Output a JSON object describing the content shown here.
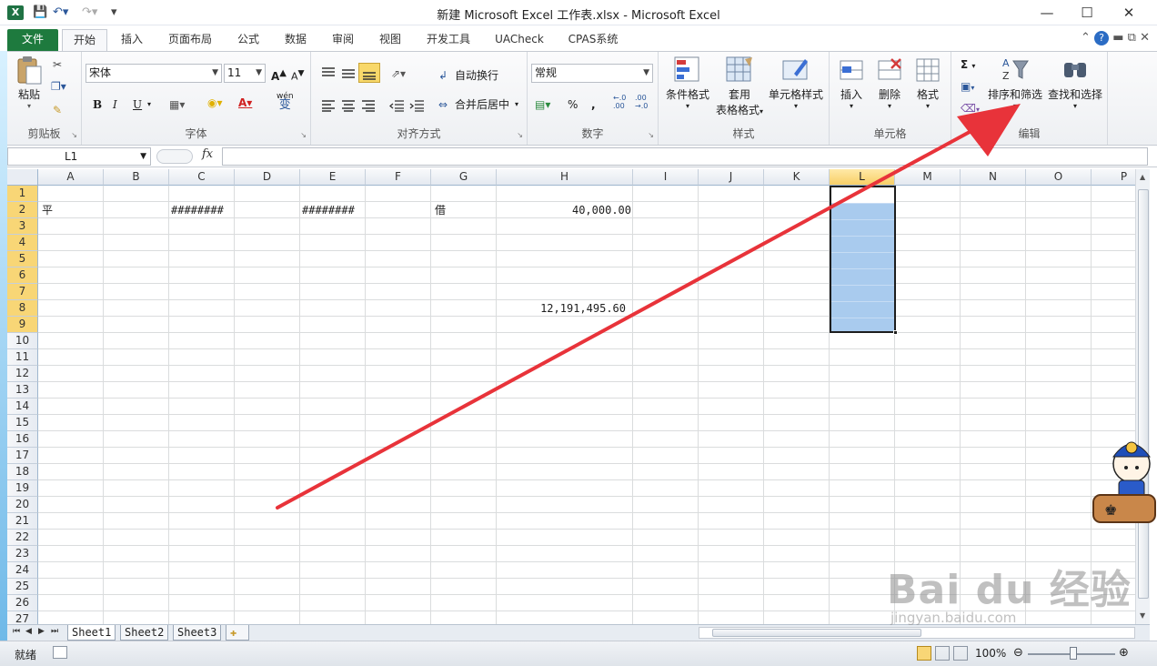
{
  "window": {
    "title": "新建 Microsoft Excel 工作表.xlsx  -  Microsoft Excel",
    "app_icon": "X"
  },
  "tabs": [
    "文件",
    "开始",
    "插入",
    "页面布局",
    "公式",
    "数据",
    "审阅",
    "视图",
    "开发工具",
    "UACheck",
    "CPAS系统"
  ],
  "ribbon": {
    "clipboard": {
      "paste": "粘贴",
      "group": "剪贴板"
    },
    "font": {
      "font_name": "宋体",
      "font_size": "11",
      "bold": "B",
      "italic": "I",
      "underline": "U",
      "grow": "A",
      "shrink": "A",
      "color_a": "A",
      "wen": "wén",
      "bian": "变",
      "group": "字体"
    },
    "alignment": {
      "wrap": "自动换行",
      "merge": "合并后居中",
      "group": "对齐方式"
    },
    "number": {
      "format": "常规",
      "percent": "%",
      "comma": ",",
      "inc": "←.0\n.00",
      "dec": ".00\n→.0",
      "group": "数字"
    },
    "styles": {
      "conditional": "条件格式",
      "table1": "套用",
      "table2": "表格格式",
      "cell": "单元格样式",
      "group": "样式"
    },
    "cells": {
      "insert": "插入",
      "delete": "删除",
      "format": "格式",
      "group": "单元格"
    },
    "editing": {
      "sigma": "Σ",
      "sort": "排序和筛选",
      "find": "查找和选择",
      "group": "编辑"
    }
  },
  "formula_bar": {
    "name_box": "L1",
    "fx": "fx",
    "value": ""
  },
  "grid": {
    "columns": [
      "A",
      "B",
      "C",
      "D",
      "E",
      "F",
      "G",
      "H",
      "I",
      "J",
      "K",
      "L",
      "M",
      "N",
      "O",
      "P"
    ],
    "selected_column": "L",
    "rows": [
      "1",
      "2",
      "3",
      "4",
      "5",
      "6",
      "7",
      "8",
      "9",
      "10",
      "11",
      "12",
      "13",
      "14",
      "15",
      "16",
      "17",
      "18",
      "19",
      "20",
      "21",
      "22",
      "23",
      "24",
      "25",
      "26",
      "27"
    ],
    "selected_rows": [
      "1",
      "2",
      "3",
      "4",
      "5",
      "6",
      "7",
      "8",
      "9"
    ],
    "cells": {
      "A2": "平",
      "C2": "########",
      "E2": "########",
      "G2": "借",
      "H2": "40,000.00",
      "H8": "12,191,495.60"
    }
  },
  "sheets": [
    "Sheet1",
    "Sheet2",
    "Sheet3"
  ],
  "active_sheet": "Sheet1",
  "status": {
    "ready": "就绪",
    "zoom": "100%"
  },
  "watermark": {
    "logo": "Bai du 经验",
    "url": "jingyan.baidu.com"
  },
  "colors": {
    "accent": "#1e7a3e",
    "selection": "#a9cbee",
    "arrow": "#e8333a"
  }
}
